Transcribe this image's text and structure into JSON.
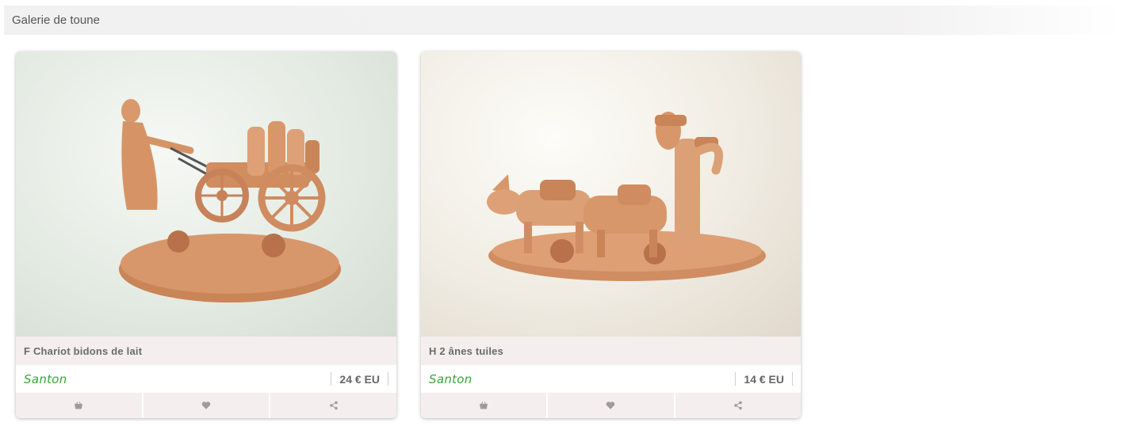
{
  "header": {
    "title": "Galerie de toune"
  },
  "products": [
    {
      "title": "F Chariot bidons de lait",
      "category": "Santon",
      "price": "24 € EU",
      "photo_subject": "terracotta santon figurine pulling a cart with milk cans"
    },
    {
      "title": "H 2 ânes tuiles",
      "category": "Santon",
      "price": "14 € EU",
      "photo_subject": "terracotta santon figurine with two donkeys carrying tiles"
    }
  ],
  "actions": {
    "basket_icon": "basket-icon",
    "heart_icon": "heart-icon",
    "share_icon": "share-icon"
  },
  "colors": {
    "category_green": "#3aa53a",
    "card_band": "#f5eeee",
    "terracotta": "#d49468"
  }
}
